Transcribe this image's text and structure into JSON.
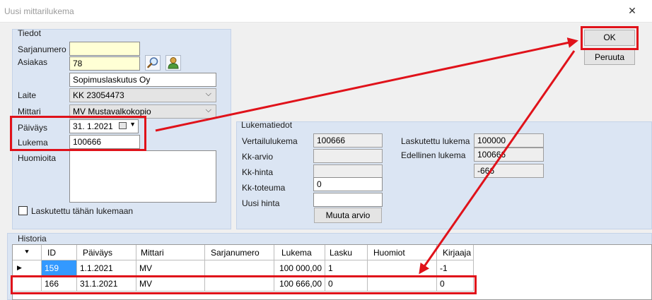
{
  "window": {
    "title": "Uusi mittarilukema",
    "close_glyph": "✕"
  },
  "actions": {
    "ok_label": "OK",
    "cancel_label": "Peruuta"
  },
  "tiedot": {
    "title": "Tiedot",
    "sarjanumero_label": "Sarjanumero",
    "sarjanumero_value": "",
    "asiakas_label": "Asiakas",
    "asiakas_value": "78",
    "customer_name": "Sopimuslaskutus Oy",
    "laite_label": "Laite",
    "laite_value": "KK  23054473",
    "mittari_label": "Mittari",
    "mittari_value": "MV  Mustavalkokopio",
    "paivays_label": "Päiväys",
    "paivays_value": "31.  1.2021",
    "lukema_label": "Lukema",
    "lukema_value": "100666",
    "huomioita_label": "Huomioita",
    "huomioita_value": "",
    "checkbox_label": "Laskutettu tähän lukemaan",
    "checkbox_checked": false,
    "search_icon": "magnifier-icon",
    "person_icon": "person-icon"
  },
  "lukematiedot": {
    "title": "Lukematiedot",
    "vertailulukema_label": "Vertailulukema",
    "vertailulukema_value": "100666",
    "kk_arvio_label": "Kk-arvio",
    "kk_arvio_value": "",
    "kk_hinta_label": "Kk-hinta",
    "kk_hinta_value": "",
    "kk_toteuma_label": "Kk-toteuma",
    "kk_toteuma_value": "0",
    "uusi_hinta_label": "Uusi hinta",
    "uusi_hinta_value": "",
    "muuta_arvio_label": "Muuta arvio",
    "laskutettu_label": "Laskutettu lukema",
    "laskutettu_value": "100000",
    "edellinen_label": "Edellinen lukema",
    "edellinen_value": "100666",
    "difference_value": "-666"
  },
  "historia": {
    "title": "Historia",
    "columns": [
      "ID",
      "Päiväys",
      "Mittari",
      "Sarjanumero",
      "Lukema",
      "Lasku",
      "Huomiot",
      "Kirjaaja"
    ],
    "rows": [
      {
        "id": "159",
        "paivays": "1.1.2021",
        "mittari": "MV",
        "sarjanumero": "",
        "lukema": "100 000,00",
        "lasku": "1",
        "huomiot": "",
        "kirjaaja": "-1"
      },
      {
        "id": "166",
        "paivays": "31.1.2021",
        "mittari": "MV",
        "sarjanumero": "",
        "lukema": "100 666,00",
        "lasku": "0",
        "huomiot": "",
        "kirjaaja": "0"
      }
    ]
  },
  "colors": {
    "annotation_red": "#e0121a",
    "panel_blue": "#dbe5f3",
    "selection_blue": "#3399ff"
  }
}
